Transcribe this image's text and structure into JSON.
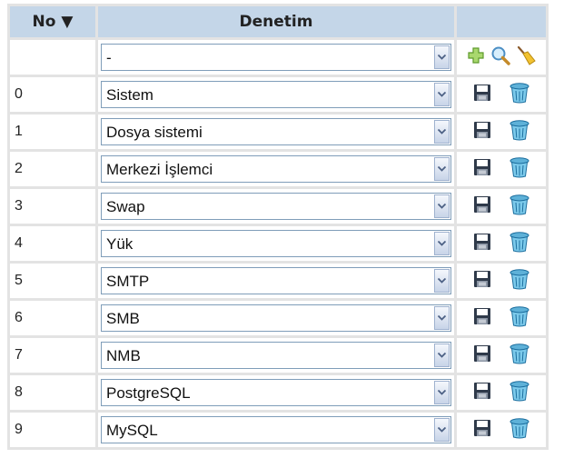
{
  "header": {
    "no_label": "No ▼",
    "column_label": "Denetim"
  },
  "filter": {
    "selected": "-"
  },
  "rows": [
    {
      "no": "0",
      "name": "Sistem"
    },
    {
      "no": "1",
      "name": "Dosya sistemi"
    },
    {
      "no": "2",
      "name": "Merkezi İşlemci"
    },
    {
      "no": "3",
      "name": "Swap"
    },
    {
      "no": "4",
      "name": "Yük"
    },
    {
      "no": "5",
      "name": "SMTP"
    },
    {
      "no": "6",
      "name": "SMB"
    },
    {
      "no": "7",
      "name": "NMB"
    },
    {
      "no": "8",
      "name": "PostgreSQL"
    },
    {
      "no": "9",
      "name": "MySQL"
    }
  ],
  "icons": {
    "add": "plus-icon",
    "search": "magnifier-icon",
    "clear": "broom-icon",
    "save": "floppy-disk-icon",
    "delete": "trash-can-icon"
  },
  "colors": {
    "header_bg": "#c4d6e8",
    "grid": "#e3e3e3",
    "select_border": "#7f9db9"
  }
}
